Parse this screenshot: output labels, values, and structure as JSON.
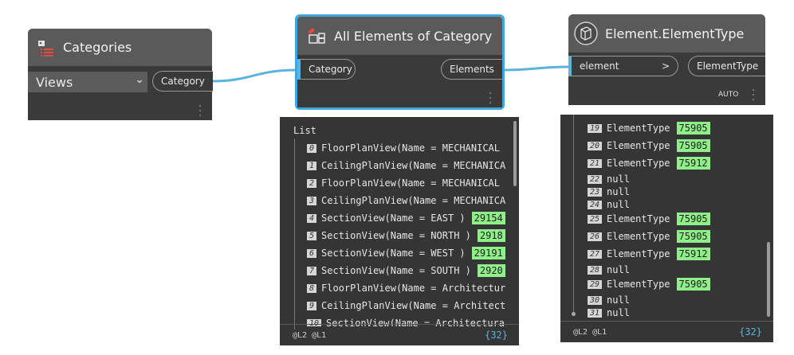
{
  "categories_node": {
    "title": "Categories",
    "dropdown_value": "Views",
    "output_port": "Category"
  },
  "all_elements_node": {
    "title": "All Elements of Category",
    "input_port": "Category",
    "output_port": "Elements"
  },
  "element_type_node": {
    "title": "Element.ElementType",
    "input_port": "element",
    "input_arrow": ">",
    "output_port": "ElementType",
    "lacing": "AUTO"
  },
  "preview_left": {
    "header": "List",
    "items": [
      {
        "index": "0",
        "text": "FloorPlanView(Name = MECHANICAL",
        "badge": ""
      },
      {
        "index": "1",
        "text": "CeilingPlanView(Name = MECHANICA",
        "badge": ""
      },
      {
        "index": "2",
        "text": "FloorPlanView(Name = MECHANICAL",
        "badge": ""
      },
      {
        "index": "3",
        "text": "CeilingPlanView(Name = MECHANICA",
        "badge": ""
      },
      {
        "index": "4",
        "text": "SectionView(Name = EAST )",
        "badge": "29154"
      },
      {
        "index": "5",
        "text": "SectionView(Name = NORTH )",
        "badge": "2918"
      },
      {
        "index": "6",
        "text": "SectionView(Name = WEST )",
        "badge": "29191"
      },
      {
        "index": "7",
        "text": "SectionView(Name = SOUTH )",
        "badge": "2920"
      },
      {
        "index": "8",
        "text": "FloorPlanView(Name = Architectur",
        "badge": ""
      },
      {
        "index": "9",
        "text": "CeilingPlanView(Name = Architect",
        "badge": ""
      },
      {
        "index": "10",
        "text": "SectionView(Name = Architectura",
        "badge": ""
      }
    ],
    "footer_levels": "@L2 @L1",
    "footer_count": "{32}"
  },
  "preview_right": {
    "items": [
      {
        "index": "19",
        "text": "ElementType",
        "badge": "75905"
      },
      {
        "index": "20",
        "text": "ElementType",
        "badge": "75905"
      },
      {
        "index": "21",
        "text": "ElementType",
        "badge": "75912"
      },
      {
        "index": "22",
        "text": "null",
        "badge": ""
      },
      {
        "index": "23",
        "text": "null",
        "badge": ""
      },
      {
        "index": "24",
        "text": "null",
        "badge": ""
      },
      {
        "index": "25",
        "text": "ElementType",
        "badge": "75905"
      },
      {
        "index": "26",
        "text": "ElementType",
        "badge": "75905"
      },
      {
        "index": "27",
        "text": "ElementType",
        "badge": "75912"
      },
      {
        "index": "28",
        "text": "null",
        "badge": ""
      },
      {
        "index": "29",
        "text": "ElementType",
        "badge": "75905"
      },
      {
        "index": "30",
        "text": "null",
        "badge": ""
      },
      {
        "index": "31",
        "text": "null",
        "badge": ""
      }
    ],
    "footer_levels": "@L2 @L1",
    "footer_count": "{32}"
  },
  "colors": {
    "wire": "#5ab4de",
    "selection": "#3da8e0",
    "badge": "#8ff08a",
    "node_body": "#3a3a3a",
    "node_header": "#5a5a5a"
  }
}
